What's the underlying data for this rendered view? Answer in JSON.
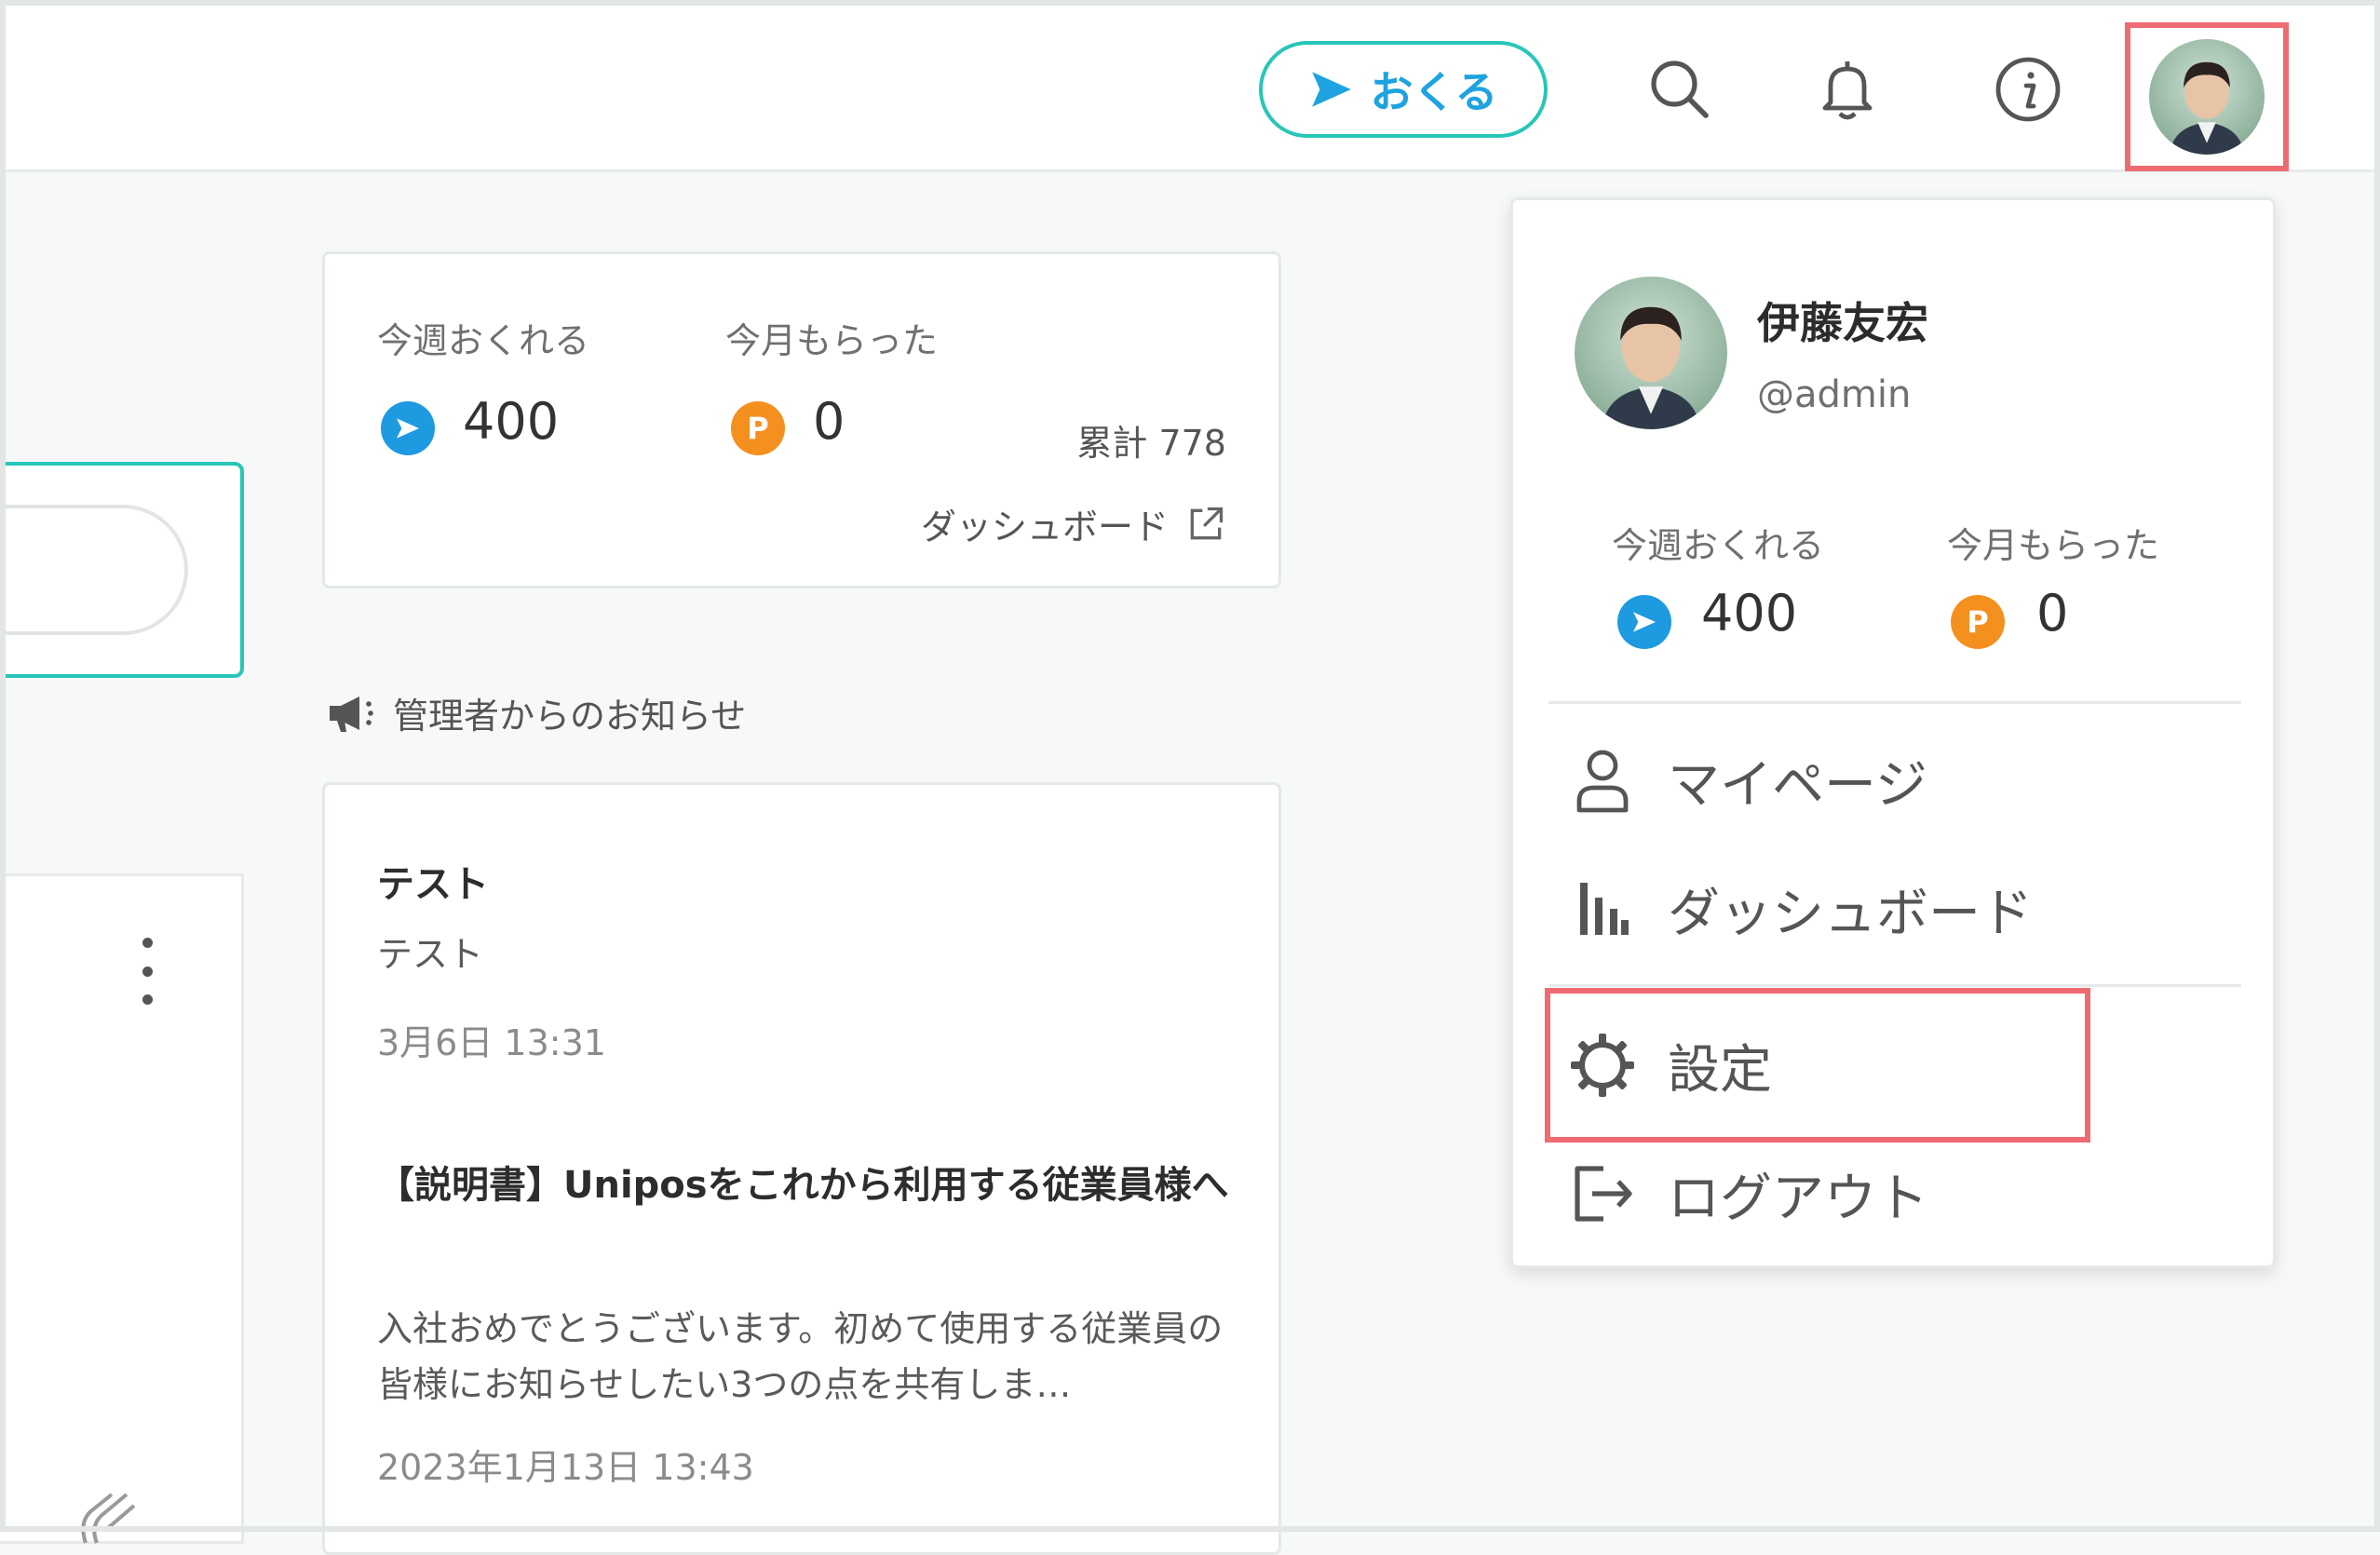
{
  "header": {
    "send_label": "おくる",
    "icons": [
      "search-icon",
      "bell-icon",
      "info-icon",
      "user-avatar"
    ]
  },
  "points_card": {
    "send_label": "今週おくれる",
    "send_value": "400",
    "received_label": "今月もらった",
    "received_value": "0",
    "coin_letter": "P",
    "total_text": "累計 778",
    "dashboard_link": "ダッシュボード"
  },
  "announcements": {
    "section_title": "管理者からのお知らせ",
    "items": [
      {
        "title": "テスト",
        "body": "テスト",
        "date": "3月6日 13:31"
      },
      {
        "title": "【説明書】Uniposをこれから利用する従業員様へ",
        "body": "入社おめでとうございます。初めて使用する従業員の皆様にお知らせしたい3つの点を共有しま…",
        "date": "2023年1月13日 13:43"
      }
    ]
  },
  "dropdown": {
    "name": "伊藤友宏",
    "handle": "@admin",
    "send_label": "今週おくれる",
    "send_value": "400",
    "received_label": "今月もらった",
    "received_value": "0",
    "coin_letter": "P",
    "menu": {
      "mypage": "マイページ",
      "dashboard": "ダッシュボード",
      "settings": "設定",
      "logout": "ログアウト"
    }
  },
  "colors": {
    "accent_teal": "#27c6b8",
    "accent_blue": "#1e9ae0",
    "point_orange": "#f4901e",
    "highlight_red": "#ef6b72"
  }
}
